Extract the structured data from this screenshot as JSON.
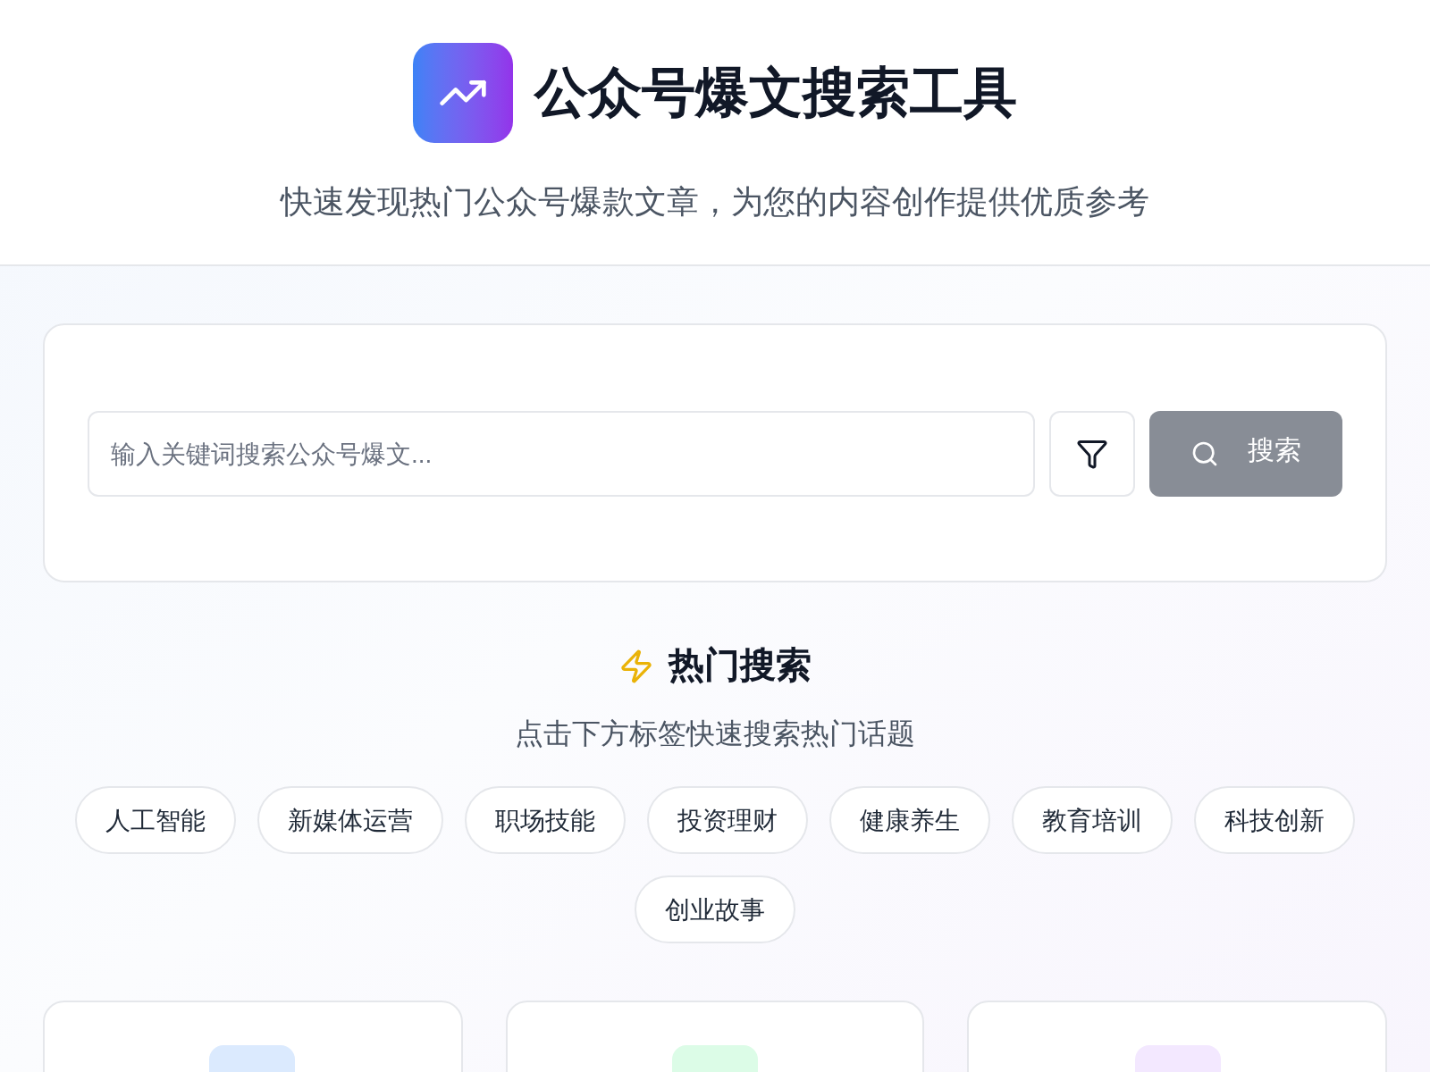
{
  "header": {
    "title": "公众号爆文搜索工具",
    "subtitle": "快速发现热门公众号爆款文章，为您的内容创作提供优质参考"
  },
  "search": {
    "placeholder": "输入关键词搜索公众号爆文...",
    "button": {
      "label": "搜索",
      "disabled": true
    }
  },
  "hot": {
    "title": "热门搜索",
    "hint": "点击下方标签快速搜索热门话题",
    "tags": [
      "人工智能",
      "新媒体运营",
      "职场技能",
      "投资理财",
      "健康养生",
      "教育培训",
      "科技创新",
      "创业故事"
    ]
  },
  "cards": [
    {
      "color": "#dbeafe"
    },
    {
      "color": "#dcfce7"
    },
    {
      "color": "#f3e8ff"
    }
  ]
}
